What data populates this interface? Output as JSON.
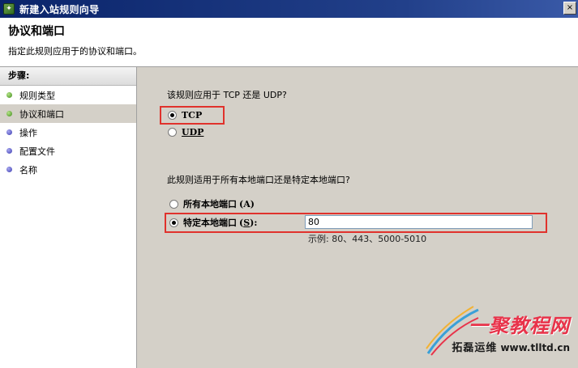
{
  "window": {
    "title": "新建入站规则向导",
    "close_label": "×"
  },
  "header": {
    "title": "协议和端口",
    "description": "指定此规则应用于的协议和端口。"
  },
  "steps": {
    "title": "步骤:",
    "items": [
      {
        "label": "规则类型",
        "status": "done"
      },
      {
        "label": "协议和端口",
        "status": "current"
      },
      {
        "label": "操作",
        "status": "pending"
      },
      {
        "label": "配置文件",
        "status": "pending"
      },
      {
        "label": "名称",
        "status": "pending"
      }
    ]
  },
  "protocol": {
    "question": "该规则应用于 TCP 还是 UDP?",
    "options": [
      {
        "label": "TCP",
        "checked": true
      },
      {
        "label": "UDP",
        "checked": false
      }
    ]
  },
  "ports": {
    "question": "此规则适用于所有本地端口还是特定本地端口?",
    "all_label": "所有本地端口",
    "all_key": "(A)",
    "specific_label": "特定本地端口",
    "specific_key_open": "(",
    "specific_key": "S",
    "specific_key_close": "):",
    "specific_checked": true,
    "value": "80",
    "example": "示例: 80、443、5000-5010"
  },
  "watermark": {
    "brand": "一聚教程网",
    "company": "拓磊运维",
    "url": "www.tlltd.cn"
  },
  "colors": {
    "titlebar": "#0a246a",
    "highlight": "#e0322c"
  }
}
